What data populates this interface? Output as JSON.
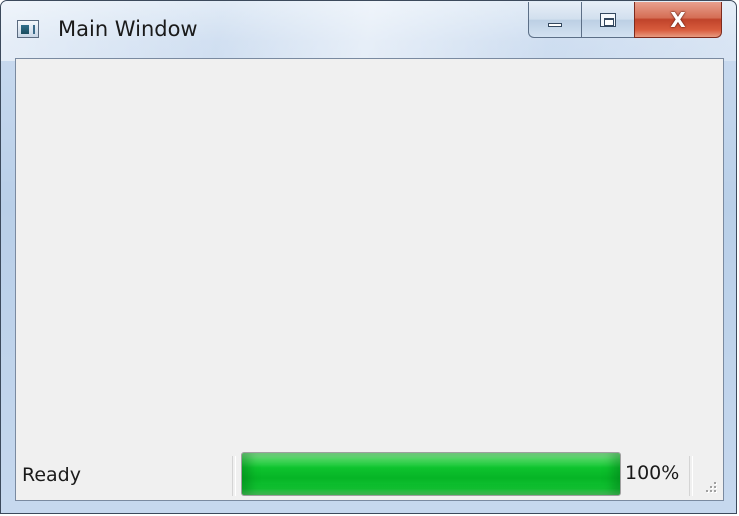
{
  "window": {
    "title": "Main Window",
    "icon": "application-icon"
  },
  "caption_buttons": {
    "minimize_icon": "minimize-icon",
    "maximize_icon": "maximize-icon",
    "close_icon": "close-icon",
    "close_glyph": "X"
  },
  "statusbar": {
    "status_text": "Ready",
    "progress_value": 100,
    "progress_label": "100%",
    "progress_color": "#0ec32e"
  },
  "colors": {
    "client_background": "#f0f0f0",
    "close_button": "#c0432a"
  }
}
